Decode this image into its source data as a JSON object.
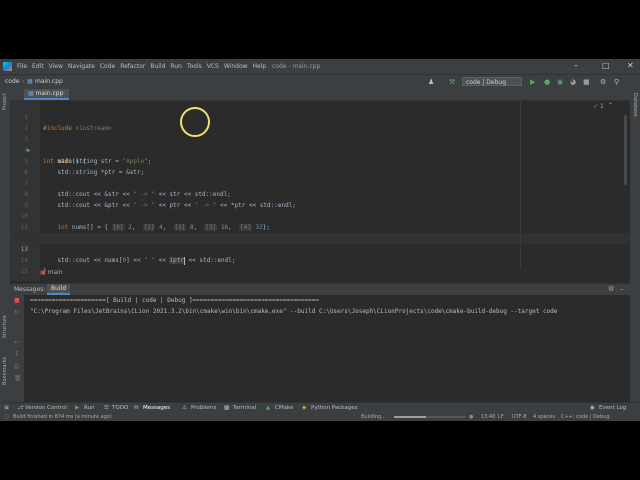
{
  "menu": [
    "File",
    "Edit",
    "View",
    "Navigate",
    "Code",
    "Refactor",
    "Build",
    "Run",
    "Tools",
    "VCS",
    "Window",
    "Help"
  ],
  "window_title": "code - main.cpp",
  "breadcrumb": {
    "project": "code",
    "file": "main.cpp"
  },
  "run_config": "code | Debug",
  "tab": {
    "label": "main.cpp"
  },
  "left_strip": [
    "Project",
    "Structure",
    "Bookmarks"
  ],
  "right_strip": [
    "Database"
  ],
  "inspection": {
    "count": "1"
  },
  "code": [
    {
      "n": "1"
    },
    {
      "n": "2"
    },
    {
      "n": "3"
    },
    {
      "n": "4"
    },
    {
      "n": "5"
    },
    {
      "n": "6"
    },
    {
      "n": "7"
    },
    {
      "n": "8"
    },
    {
      "n": "9"
    },
    {
      "n": "10"
    },
    {
      "n": "11"
    },
    {
      "n": "12"
    },
    {
      "n": "13"
    },
    {
      "n": "14"
    },
    {
      "n": "15"
    }
  ],
  "editor_footer": "main",
  "build_panel": {
    "tabs": [
      "Messages:",
      "Build"
    ],
    "output": [
      "=====================[ Build | code | Debug ]===================================",
      "\"C:\\Program Files\\JetBrains\\CLion 2021.3.2\\bin\\cmake\\win\\bin\\cmake.exe\" --build C:\\Users\\Joseph\\CLionProjects\\code\\cmake-build-debug --target code"
    ]
  },
  "toolwindows": [
    "Version Control",
    "Run",
    "TODO",
    "Messages",
    "Problems",
    "Terminal",
    "CMake",
    "Python Packages"
  ],
  "event_log": "Event Log",
  "status": {
    "message": "Build finished in 874 ms (a minute ago)",
    "task": "Building...",
    "progress": 0.45,
    "position": "13:40",
    "line_sep": "LF",
    "encoding": "UTF-8",
    "indent": "4 spaces",
    "context": "C++: code | Debug"
  }
}
